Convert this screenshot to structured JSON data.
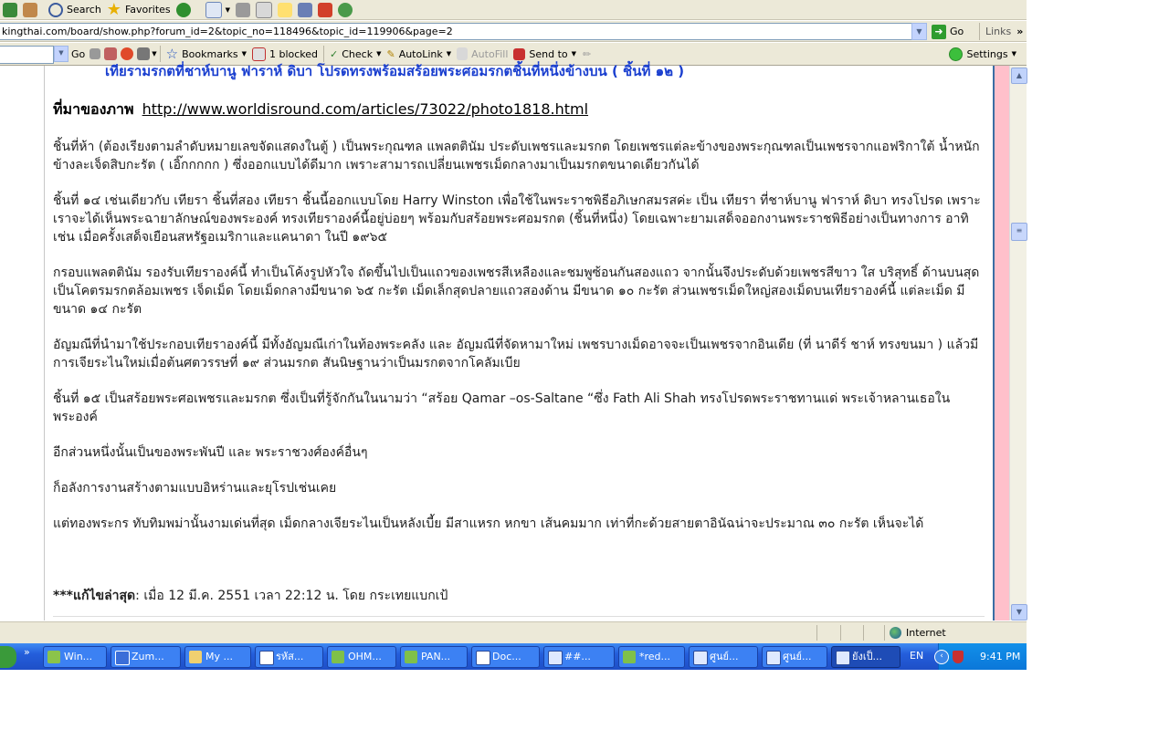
{
  "toolbar": {
    "search_label": "Search",
    "favorites_label": "Favorites"
  },
  "address": {
    "url": "kingthai.com/board/show.php?forum_id=2&topic_no=118496&topic_id=119906&page=2",
    "go_label": "Go",
    "links_label": "Links"
  },
  "google_bar": {
    "go_label": "Go",
    "bookmarks_label": "Bookmarks",
    "blocked_label": "1 blocked",
    "check_label": "Check",
    "autolink_label": "AutoLink",
    "autofill_label": "AutoFill",
    "sendto_label": "Send to",
    "settings_label": "Settings"
  },
  "content": {
    "top_cut_line": "เทียรามรกตที่ชาห์บานู ฟาราห์ ดิบา โปรดทรงพร้อมสร้อยพระศอมรกตชิ้นที่หนึ่งข้างบน ( ชิ้นที่ ๑๒ )",
    "source_label": "ที่มาของภาพ",
    "source_link": "http://www.worldisround.com/articles/73022/photo1818.html",
    "paragraphs": [
      "ชิ้นที่ห้า (ต้องเรียงตามลำดับหมายเลขจัดแสดงในตู้ ) เป็นพระกุณฑล แพลตตินัม ประดับเพชรและมรกต โดยเพชรแต่ละข้างของพระกุณฑลเป็นเพชรจากแอฟริกาใต้ น้ำหนักข้างละเจ็ดสิบกะรัต ( เอิ๊กกกกก ) ซึ่งออกแบบได้ดีมาก เพราะสามารถเปลี่ยนเพชรเม็ดกลางมาเป็นมรกตขนาดเดียวกันได้",
      "ชิ้นที่ ๑๔ เช่นเดียวกับ เทียรา ชิ้นที่สอง เทียรา ชิ้นนี้ออกแบบโดย Harry Winston เพื่อใช้ในพระราชพิธีอภิเษกสมรสค่ะ   เป็น เทียรา ที่ชาห์บานู ฟาราห์ ดิบา ทรงโปรด เพราะเราจะได้เห็นพระฉายาลักษณ์ของพระองค์ ทรงเทียราองค์นี้อยู่บ่อยๆ พร้อมกับสร้อยพระศอมรกต (ชิ้นที่หนึ่ง) โดยเฉพาะยามเสด็จออกงานพระราชพิธีอย่างเป็นทางการ อาทิเช่น เมื่อครั้งเสด็จเยือนสหรัฐอเมริกาและแคนาดา ในปี ๑๙๖๕",
      "กรอบแพลตตินัม รองรับเทียราองค์นี้ ทำเป็นโค้งรูปหัวใจ ถัดขึ้นไปเป็นแถวของเพชรสีเหลืองและชมพูซ้อนกันสองแถว จากนั้นจึงประดับด้วยเพชรสีขาว ใส บริสุทธิ์ ด้านบนสุดเป็นโคตรมรกตล้อมเพชร เจ็ดเม็ด โดยเม็ดกลางมีขนาด ๖๕ กะรัต เม็ดเล็กสุดปลายแถวสองด้าน มีขนาด ๑๐ กะรัต ส่วนเพชรเม็ดใหญ่สองเม็ดบนเทียราองค์นี้ แต่ละเม็ด มีขนาด ๑๔ กะรัต",
      "อัญมณีที่นำมาใช้ประกอบเทียราองค์นี้ มีทั้งอัญมณีเก่าในท้องพระคลัง และ อัญมณีที่จัดหามาใหม่ เพชรบางเม็ดอาจจะเป็นเพชรจากอินเดีย (ที่ นาดีร์ ชาห์ ทรงขนมา ) แล้วมีการเจียระไนใหม่เมื่อต้นศตวรรษที่ ๑๙ ส่วนมรกต สันนิษฐานว่าเป็นมรกตจากโคลัมเบีย",
      "ชิ้นที่ ๑๕ เป็นสร้อยพระศอเพชรและมรกต ซึ่งเป็นที่รู้จักกันในนามว่า  “สร้อย Qamar –os-Saltane “ซึ่ง Fath Ali Shah ทรงโปรดพระราชทานแด่ พระเจ้าหลานเธอในพระองค์",
      "อีกส่วนหนึ่งนั้นเป็นของพระพันปี และ พระราชวงศ์องค์อื่นๆ",
      "ก็อลังการงานสร้างตามแบบอิหร่านและยุโรปเช่นเคย",
      "แต่ทองพระกร ทับทิมพม่านั้นงามเด่นที่สุด เม็ดกลางเจียระไนเป็นหลังเบี้ย มีสาแหรก หกขา เส้นคมมาก เท่าที่กะด้วยสายตาอินัฉน่าจะประมาณ ๓๐ กะรัต เห็นจะได้"
    ],
    "edit_label": "***แก้ไขล่าสุด",
    "edit_text": ": เมื่อ 12 มี.ค. 2551 เวลา 22:12 น. โดย กระเทยแบกเป้"
  },
  "status": {
    "zone_label": "Internet"
  },
  "taskbar": {
    "tasks": [
      "Win...",
      "Zum...",
      "My ...",
      "รหัส...",
      "OHM...",
      "PAN...",
      "Doc...",
      "##...",
      "*red...",
      "ศูนย์...",
      "ศูนย์...",
      "ยังเป็..."
    ],
    "language": "EN",
    "clock": "9:41 PM"
  },
  "colors": {
    "chrome": "#ece9d8",
    "taskbar_blue": "#245edb",
    "tray_blue": "#0b77d9",
    "pink_band": "#ffc0cb",
    "cut_line_blue": "#1a3fcf",
    "go_green": "#2f9c2f"
  },
  "icons": [
    "refresh-icon",
    "home-icon",
    "search-icon",
    "favorites-star-icon",
    "history-icon",
    "mail-icon",
    "print-icon",
    "edit-icon",
    "messenger-icon",
    "go-arrow-icon",
    "globe-icon",
    "shield-icon"
  ]
}
